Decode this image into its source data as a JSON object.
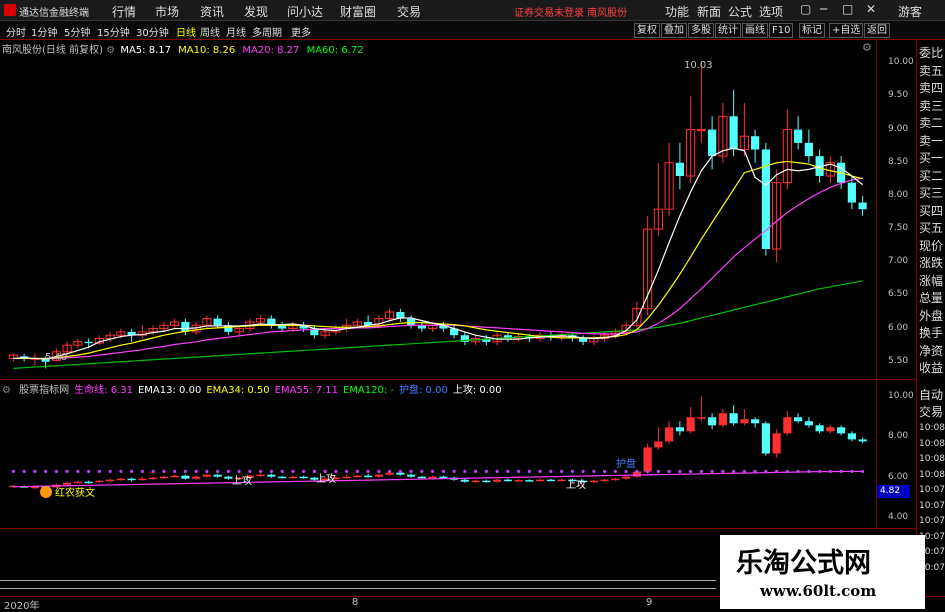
{
  "app": {
    "title": "通达信金融终端",
    "notice": "证券交易未登录  南风股份"
  },
  "menu": [
    "行情",
    "市场",
    "资讯",
    "发现",
    "问小达",
    "财富圈",
    "交易"
  ],
  "right_menu": [
    "功能",
    "新面",
    "公式",
    "选项"
  ],
  "window_buttons": [
    "▢",
    "─",
    "□",
    "✕"
  ],
  "periods": [
    "分时",
    "1分钟",
    "5分钟",
    "15分钟",
    "30分钟",
    "日线",
    "周线",
    "月线",
    "多周期",
    "更多"
  ],
  "active_period": "日线",
  "tools": [
    "复权",
    "叠加",
    "多股",
    "统计",
    "画线",
    "F10",
    "标记",
    "+自选",
    "返回"
  ],
  "guest": "游客",
  "main_legend": {
    "stock": "南风股份(日线 前复权)",
    "ma": [
      {
        "label": "MA5: 8.17",
        "color": "#ffffff"
      },
      {
        "label": "MA10: 8.26",
        "color": "#ffff00"
      },
      {
        "label": "MA20: 8.27",
        "color": "#ff40ff"
      },
      {
        "label": "MA60: 6.72",
        "color": "#00ff00"
      }
    ]
  },
  "ind_legend": [
    {
      "label": "股票指标网",
      "color": "#c0c0c0"
    },
    {
      "label": "生命线: 6.31",
      "color": "#ff40ff"
    },
    {
      "label": "EMA13: 0.00",
      "color": "#ffffff"
    },
    {
      "label": "EMA34: 0.50",
      "color": "#ffff00"
    },
    {
      "label": "EMA55: 7.11",
      "color": "#ff40ff"
    },
    {
      "label": "EMA120: -",
      "color": "#00ff00"
    },
    {
      "label": "护盘: 0.00",
      "color": "#4080ff"
    },
    {
      "label": "上攻: 0.00",
      "color": "#ffffff"
    }
  ],
  "main_axis": [
    "10.00",
    "9.50",
    "9.00",
    "8.50",
    "8.00",
    "7.50",
    "7.00",
    "6.50",
    "6.00",
    "5.50"
  ],
  "ind_axis": [
    "10.00",
    "8.00",
    "6.00",
    "4.00"
  ],
  "ind_marker": "4.82",
  "annotations": {
    "high": "10.03",
    "low": "5.40",
    "hong": "红农获文",
    "shanggong": "上攻",
    "hupan": "护盘"
  },
  "side_labels": [
    "委比",
    "卖五",
    "卖四",
    "卖三",
    "卖二",
    "卖一",
    "买一",
    "买二",
    "买三",
    "买四",
    "买五",
    "现价",
    "涨跌",
    "涨幅",
    "总量",
    "外盘",
    "换手",
    "净资",
    "收益"
  ],
  "side_lower": [
    "自动",
    "交易"
  ],
  "side_times": [
    "10:08",
    "10:08",
    "10:08",
    "10:08",
    "10:07",
    "10:07",
    "10:07",
    "10:07",
    "10:07",
    "10:07"
  ],
  "x_axis": [
    "2020年",
    "8",
    "9"
  ],
  "watermark": {
    "title": "乐淘公式网",
    "url": "www.60lt.com"
  },
  "chart_data": {
    "type": "candlestick",
    "ylim": [
      5.3,
      10.2
    ],
    "candles": [
      [
        5.55,
        5.6,
        5.5,
        5.62
      ],
      [
        5.58,
        5.55,
        5.5,
        5.62
      ],
      [
        5.55,
        5.55,
        5.45,
        5.62
      ],
      [
        5.55,
        5.5,
        5.4,
        5.58
      ],
      [
        5.52,
        5.65,
        5.5,
        5.7
      ],
      [
        5.65,
        5.75,
        5.6,
        5.8
      ],
      [
        5.75,
        5.8,
        5.7,
        5.85
      ],
      [
        5.8,
        5.78,
        5.7,
        5.85
      ],
      [
        5.78,
        5.85,
        5.75,
        5.9
      ],
      [
        5.85,
        5.9,
        5.8,
        5.95
      ],
      [
        5.9,
        5.95,
        5.85,
        6.0
      ],
      [
        5.95,
        5.9,
        5.8,
        6.0
      ],
      [
        5.9,
        5.95,
        5.85,
        6.05
      ],
      [
        5.95,
        6.0,
        5.9,
        6.05
      ],
      [
        6.0,
        6.05,
        5.95,
        6.1
      ],
      [
        6.05,
        6.1,
        6.0,
        6.15
      ],
      [
        6.1,
        5.95,
        5.9,
        6.15
      ],
      [
        5.95,
        6.05,
        5.9,
        6.1
      ],
      [
        6.05,
        6.15,
        6.0,
        6.2
      ],
      [
        6.15,
        6.05,
        6.0,
        6.2
      ],
      [
        6.05,
        5.95,
        5.9,
        6.1
      ],
      [
        5.95,
        6.0,
        5.9,
        6.05
      ],
      [
        6.0,
        6.1,
        5.95,
        6.15
      ],
      [
        6.1,
        6.15,
        6.05,
        6.2
      ],
      [
        6.15,
        6.05,
        6.0,
        6.2
      ],
      [
        6.05,
        6.0,
        5.95,
        6.1
      ],
      [
        6.0,
        6.05,
        5.95,
        6.1
      ],
      [
        6.05,
        6.0,
        5.95,
        6.1
      ],
      [
        6.0,
        5.9,
        5.85,
        6.05
      ],
      [
        5.9,
        5.95,
        5.85,
        6.0
      ],
      [
        5.95,
        6.0,
        5.9,
        6.05
      ],
      [
        6.0,
        6.05,
        5.95,
        6.15
      ],
      [
        6.05,
        6.1,
        6.0,
        6.15
      ],
      [
        6.1,
        6.05,
        6.0,
        6.2
      ],
      [
        6.05,
        6.15,
        6.0,
        6.2
      ],
      [
        6.15,
        6.25,
        6.1,
        6.3
      ],
      [
        6.25,
        6.15,
        6.1,
        6.3
      ],
      [
        6.15,
        6.05,
        6.0,
        6.2
      ],
      [
        6.05,
        6.0,
        5.95,
        6.1
      ],
      [
        6.0,
        6.05,
        5.95,
        6.1
      ],
      [
        6.05,
        6.0,
        5.95,
        6.1
      ],
      [
        6.0,
        5.9,
        5.85,
        6.05
      ],
      [
        5.9,
        5.8,
        5.75,
        5.95
      ],
      [
        5.8,
        5.85,
        5.75,
        5.9
      ],
      [
        5.85,
        5.8,
        5.75,
        5.9
      ],
      [
        5.8,
        5.9,
        5.75,
        5.95
      ],
      [
        5.9,
        5.85,
        5.8,
        5.95
      ],
      [
        5.85,
        5.88,
        5.8,
        5.92
      ],
      [
        5.88,
        5.85,
        5.8,
        5.92
      ],
      [
        5.85,
        5.9,
        5.8,
        5.95
      ],
      [
        5.9,
        5.88,
        5.82,
        5.95
      ],
      [
        5.88,
        5.9,
        5.82,
        5.95
      ],
      [
        5.9,
        5.85,
        5.8,
        5.95
      ],
      [
        5.85,
        5.8,
        5.75,
        5.9
      ],
      [
        5.8,
        5.85,
        5.75,
        5.9
      ],
      [
        5.85,
        5.9,
        5.8,
        5.95
      ],
      [
        5.9,
        5.95,
        5.85,
        6.0
      ],
      [
        5.95,
        6.05,
        5.9,
        6.1
      ],
      [
        6.05,
        6.3,
        6.0,
        6.4
      ],
      [
        6.3,
        7.5,
        6.2,
        7.7
      ],
      [
        7.5,
        7.8,
        7.4,
        8.5
      ],
      [
        7.8,
        8.5,
        7.7,
        8.8
      ],
      [
        8.5,
        8.3,
        8.1,
        8.8
      ],
      [
        8.3,
        9.0,
        8.2,
        9.5
      ],
      [
        9.0,
        9.0,
        8.8,
        10.03
      ],
      [
        9.0,
        8.6,
        8.4,
        9.2
      ],
      [
        8.6,
        9.2,
        8.5,
        9.4
      ],
      [
        9.2,
        8.7,
        8.6,
        9.6
      ],
      [
        8.7,
        8.9,
        8.6,
        9.4
      ],
      [
        8.9,
        8.7,
        8.5,
        9.0
      ],
      [
        8.7,
        7.2,
        7.1,
        8.8
      ],
      [
        7.2,
        8.2,
        7.0,
        8.4
      ],
      [
        8.2,
        9.0,
        8.1,
        9.3
      ],
      [
        9.0,
        8.8,
        8.7,
        9.2
      ],
      [
        8.8,
        8.6,
        8.5,
        9.0
      ],
      [
        8.6,
        8.3,
        8.2,
        8.7
      ],
      [
        8.3,
        8.5,
        8.2,
        8.6
      ],
      [
        8.5,
        8.2,
        8.1,
        8.6
      ],
      [
        8.2,
        7.9,
        7.8,
        8.3
      ],
      [
        7.9,
        7.8,
        7.7,
        8.0
      ]
    ],
    "ma5": [
      5.55,
      5.56,
      5.55,
      5.54,
      5.58,
      5.62,
      5.67,
      5.72,
      5.8,
      5.84,
      5.88,
      5.9,
      5.91,
      5.94,
      5.96,
      6.0,
      6.0,
      6.01,
      6.04,
      6.04,
      6.04,
      6.04,
      6.05,
      6.07,
      6.06,
      6.06,
      6.07,
      6.05,
      6.0,
      5.98,
      5.97,
      6.0,
      6.02,
      6.05,
      6.07,
      6.12,
      6.16,
      6.16,
      6.12,
      6.08,
      6.05,
      6.0,
      5.95,
      5.9,
      5.87,
      5.84,
      5.84,
      5.84,
      5.86,
      5.87,
      5.88,
      5.89,
      5.88,
      5.86,
      5.85,
      5.86,
      5.89,
      5.97,
      6.13,
      6.5,
      6.88,
      7.3,
      7.7,
      8.06,
      8.38,
      8.6,
      8.68,
      8.72,
      8.68,
      8.28,
      8.16,
      8.32,
      8.4,
      8.38,
      8.4,
      8.44,
      8.48,
      8.42,
      8.3,
      8.17
    ],
    "ma10": [
      5.55,
      5.55,
      5.55,
      5.55,
      5.56,
      5.58,
      5.6,
      5.63,
      5.67,
      5.71,
      5.75,
      5.78,
      5.82,
      5.86,
      5.9,
      5.93,
      5.96,
      5.98,
      6.0,
      6.01,
      6.02,
      6.03,
      6.04,
      6.05,
      6.05,
      6.05,
      6.05,
      6.05,
      6.04,
      6.03,
      6.02,
      6.02,
      6.02,
      6.03,
      6.04,
      6.06,
      6.08,
      6.09,
      6.09,
      6.08,
      6.07,
      6.06,
      6.04,
      6.01,
      5.98,
      5.96,
      5.94,
      5.92,
      5.9,
      5.88,
      5.87,
      5.86,
      5.86,
      5.86,
      5.86,
      5.87,
      5.88,
      5.91,
      5.98,
      6.15,
      6.35,
      6.58,
      6.82,
      7.08,
      7.35,
      7.6,
      7.85,
      8.1,
      8.35,
      8.4,
      8.45,
      8.5,
      8.52,
      8.5,
      8.48,
      8.42,
      8.38,
      8.35,
      8.3,
      8.26
    ],
    "ma20": [
      5.55,
      5.55,
      5.55,
      5.55,
      5.55,
      5.56,
      5.57,
      5.58,
      5.6,
      5.62,
      5.64,
      5.66,
      5.68,
      5.71,
      5.73,
      5.76,
      5.78,
      5.8,
      5.83,
      5.85,
      5.87,
      5.89,
      5.91,
      5.93,
      5.95,
      5.96,
      5.97,
      5.98,
      5.99,
      6.0,
      6.0,
      6.0,
      6.01,
      6.01,
      6.02,
      6.03,
      6.04,
      6.05,
      6.05,
      6.05,
      6.05,
      6.05,
      6.04,
      6.03,
      6.02,
      6.01,
      6.0,
      5.99,
      5.98,
      5.97,
      5.96,
      5.95,
      5.94,
      5.93,
      5.92,
      5.92,
      5.92,
      5.93,
      5.95,
      6.0,
      6.08,
      6.18,
      6.3,
      6.45,
      6.6,
      6.76,
      6.92,
      7.08,
      7.22,
      7.35,
      7.48,
      7.62,
      7.75,
      7.86,
      7.96,
      8.05,
      8.13,
      8.19,
      8.24,
      8.27
    ],
    "ma60": [
      5.4,
      5.41,
      5.42,
      5.43,
      5.44,
      5.45,
      5.46,
      5.47,
      5.48,
      5.49,
      5.5,
      5.51,
      5.52,
      5.53,
      5.54,
      5.55,
      5.56,
      5.57,
      5.58,
      5.59,
      5.6,
      5.61,
      5.62,
      5.63,
      5.64,
      5.65,
      5.66,
      5.67,
      5.68,
      5.69,
      5.7,
      5.71,
      5.72,
      5.73,
      5.74,
      5.75,
      5.76,
      5.77,
      5.78,
      5.79,
      5.8,
      5.81,
      5.82,
      5.83,
      5.84,
      5.85,
      5.86,
      5.87,
      5.88,
      5.89,
      5.9,
      5.91,
      5.92,
      5.93,
      5.94,
      5.95,
      5.96,
      5.97,
      5.98,
      6.0,
      6.02,
      6.05,
      6.08,
      6.12,
      6.16,
      6.2,
      6.24,
      6.28,
      6.32,
      6.36,
      6.4,
      6.44,
      6.48,
      6.52,
      6.56,
      6.6,
      6.63,
      6.66,
      6.69,
      6.72
    ],
    "ind_ylim": [
      3.8,
      10.6
    ],
    "lifeline": [
      5.55,
      5.56,
      5.57,
      5.58,
      5.59,
      5.6,
      5.61,
      5.62,
      5.63,
      5.64,
      5.65,
      5.66,
      5.67,
      5.68,
      5.69,
      5.7,
      5.71,
      5.72,
      5.73,
      5.74,
      5.75,
      5.76,
      5.77,
      5.78,
      5.79,
      5.8,
      5.81,
      5.82,
      5.83,
      5.84,
      5.85,
      5.86,
      5.87,
      5.88,
      5.89,
      5.9,
      5.91,
      5.92,
      5.93,
      5.94,
      5.95,
      5.96,
      5.97,
      5.98,
      5.99,
      6.0,
      6.01,
      6.02,
      6.03,
      6.04,
      6.05,
      6.06,
      6.07,
      6.08,
      6.09,
      6.1,
      6.11,
      6.12,
      6.13,
      6.14,
      6.15,
      6.16,
      6.17,
      6.18,
      6.19,
      6.2,
      6.21,
      6.22,
      6.23,
      6.24,
      6.25,
      6.26,
      6.27,
      6.28,
      6.29,
      6.3,
      6.3,
      6.31,
      6.31,
      6.31
    ],
    "dots_level": 6.31
  }
}
